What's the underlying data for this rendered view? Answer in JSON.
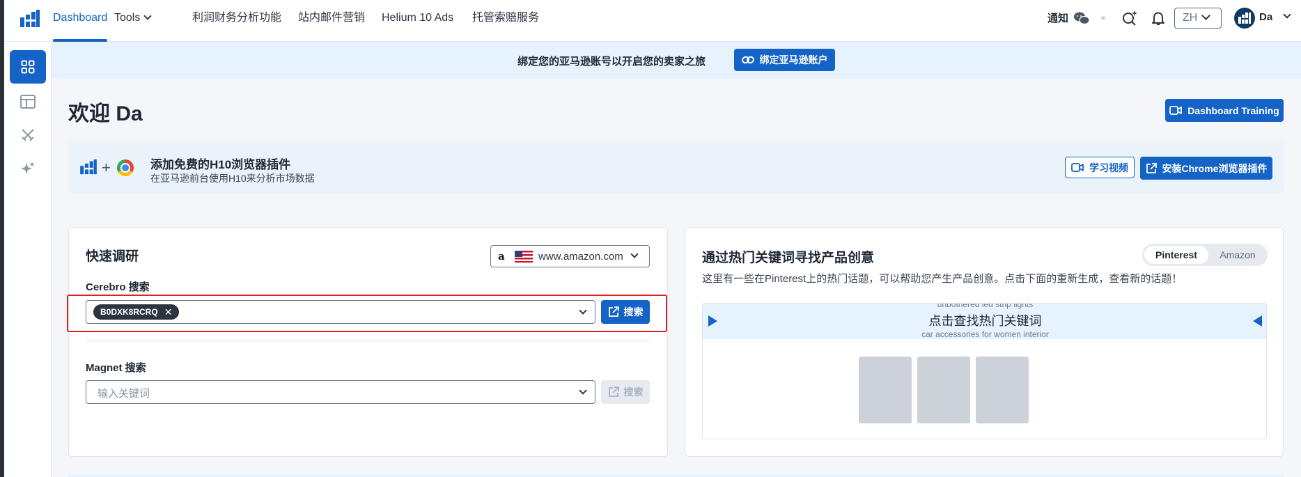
{
  "nav": {
    "items": [
      {
        "label": "Dashboard",
        "active": true
      },
      {
        "label": "Tools",
        "dropdown": true
      },
      {
        "label": "利润财务分析功能"
      },
      {
        "label": "站内邮件营销"
      },
      {
        "label": "Helium 10 Ads"
      },
      {
        "label": "托管索赔服务"
      }
    ],
    "notify_label": "通知",
    "language": "ZH",
    "user": "Da"
  },
  "banner": {
    "text": "绑定您的亚马逊账号以开启您的卖家之旅",
    "button_label": "绑定亚马逊账户"
  },
  "welcome": "欢迎 Da",
  "training_button": "Dashboard Training",
  "extension": {
    "plus": "+",
    "title": "添加免费的H10浏览器插件",
    "subtitle": "在亚马逊前台使用H10来分析市场数据",
    "video_button": "学习视频",
    "install_button": "安装Chrome浏览器插件"
  },
  "quick_research": {
    "title": "快速调研",
    "marketplace": "www.amazon.com",
    "cerebro_label": "Cerebro 搜索",
    "cerebro_chip": "B0DXK8RCRQ",
    "cerebro_search": "搜索",
    "magnet_label": "Magnet 搜索",
    "magnet_placeholder": "输入关键词",
    "magnet_search": "搜索"
  },
  "trending": {
    "title": "通过热门关键词寻找产品创意",
    "toggle_on": "Pinterest",
    "toggle_off": "Amazon",
    "description": "这里有一些在Pinterest上的热门话题，可以帮助您产生产品创意。点击下面的重新生成，查看新的话题！",
    "prev_keyword": "unbothered led strip lights",
    "main_keyword": "点击查找热门关键词",
    "next_keyword": "car accessories for women interior"
  },
  "colors": {
    "accent": "#1463c7",
    "highlight": "#e02020"
  }
}
